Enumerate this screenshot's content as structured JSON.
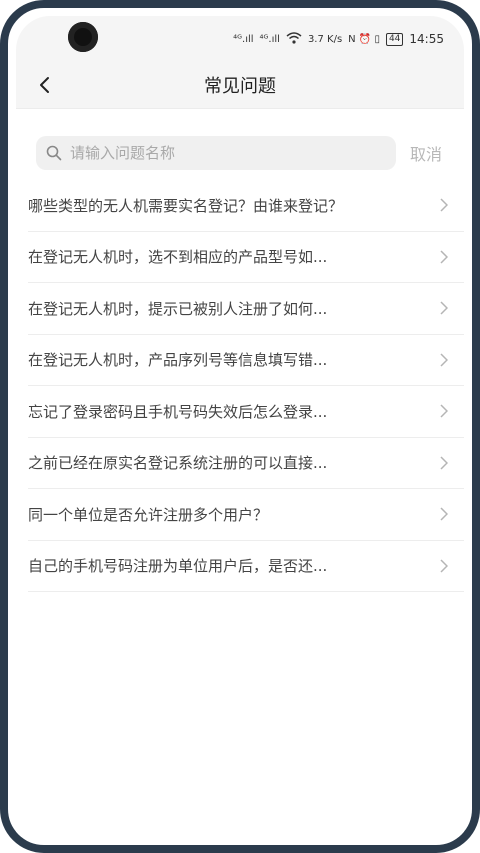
{
  "status_bar": {
    "signal1": "⁴ᴳ.ıll",
    "signal2": "⁴ᴳ.ıll",
    "wifi": "wifi",
    "speed": "3.7 K/s",
    "icons": "N ⏰ ▯",
    "battery": "44",
    "time": "14:55"
  },
  "header": {
    "title": "常见问题"
  },
  "search": {
    "placeholder": "请输入问题名称",
    "cancel_label": "取消"
  },
  "faq": [
    {
      "text": "哪些类型的无人机需要实名登记？由谁来登记？"
    },
    {
      "text": "在登记无人机时，选不到相应的产品型号如..."
    },
    {
      "text": "在登记无人机时，提示已被别人注册了如何..."
    },
    {
      "text": "在登记无人机时，产品序列号等信息填写错..."
    },
    {
      "text": "忘记了登录密码且手机号码失效后怎么登录..."
    },
    {
      "text": "之前已经在原实名登记系统注册的可以直接..."
    },
    {
      "text": "同一个单位是否允许注册多个用户？"
    },
    {
      "text": "自己的手机号码注册为单位用户后，是否还..."
    }
  ]
}
